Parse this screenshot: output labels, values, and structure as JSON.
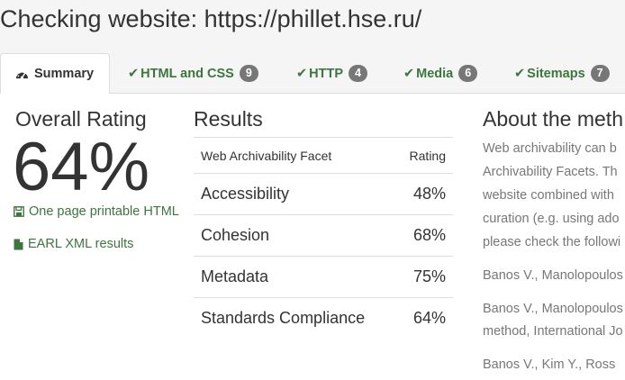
{
  "page": {
    "title": "Checking website: https://phillet.hse.ru/"
  },
  "tabs": [
    {
      "label": "Summary",
      "badge": null,
      "active": true
    },
    {
      "label": "HTML and CSS",
      "badge": "9"
    },
    {
      "label": "HTTP",
      "badge": "4"
    },
    {
      "label": "Media",
      "badge": "6"
    },
    {
      "label": "Sitemaps",
      "badge": "7"
    }
  ],
  "overall": {
    "title": "Overall Rating",
    "value": "64%",
    "printable_link": "One page printable HTML",
    "earl_link": "EARL XML results"
  },
  "results": {
    "title": "Results",
    "headers": [
      "Web Archivability Facet",
      "Rating"
    ],
    "rows": [
      {
        "facet": "Accessibility",
        "rating": "48%"
      },
      {
        "facet": "Cohesion",
        "rating": "68%"
      },
      {
        "facet": "Metadata",
        "rating": "75%"
      },
      {
        "facet": "Standards Compliance",
        "rating": "64%"
      }
    ]
  },
  "about": {
    "title": "About the meth",
    "paragraph": [
      "Web archivability can b",
      "Archivability Facets. Th",
      "website combined with",
      "curation (e.g. using ado",
      "please check the followi"
    ],
    "refs": [
      "Banos V., Manolopoulos",
      "Banos V., Manolopoulos",
      "method, International Jo",
      "Banos V., Kim Y., Ross"
    ]
  },
  "colors": {
    "accent_green": "#3c763d",
    "badge_gray": "#777777",
    "muted_text": "#777777"
  }
}
